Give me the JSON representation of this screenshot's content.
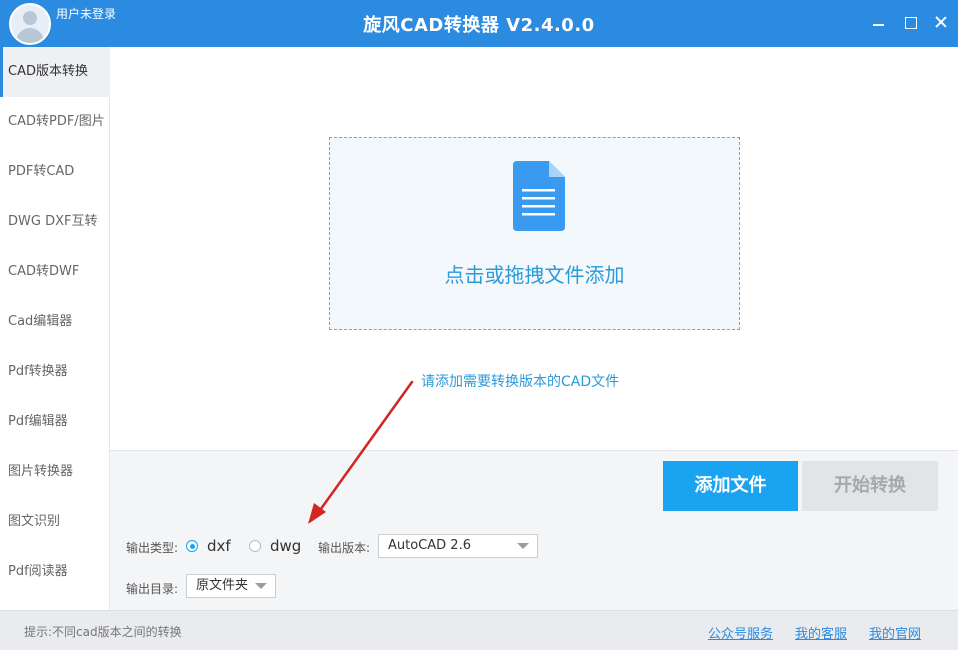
{
  "window": {
    "title": "旋风CAD转换器 V2.4.0.0",
    "user_status": "用户未登录"
  },
  "sidebar": {
    "items": [
      {
        "label": "CAD版本转换",
        "active": true
      },
      {
        "label": "CAD转PDF/图片"
      },
      {
        "label": "PDF转CAD"
      },
      {
        "label": "DWG DXF互转"
      },
      {
        "label": "CAD转DWF"
      },
      {
        "label": "Cad编辑器"
      },
      {
        "label": "Pdf转换器"
      },
      {
        "label": "Pdf编辑器"
      },
      {
        "label": "图片转换器"
      },
      {
        "label": "图文识别"
      },
      {
        "label": "Pdf阅读器"
      }
    ]
  },
  "dropzone": {
    "text": "点击或拖拽文件添加",
    "icon": "document-icon"
  },
  "hint": "请添加需要转换版本的CAD文件",
  "buttons": {
    "add": "添加文件",
    "start": "开始转换"
  },
  "options": {
    "output_type_label": "输出类型:",
    "type_dxf": "dxf",
    "type_dwg": "dwg",
    "selected_type": "dxf",
    "output_version_label": "输出版本:",
    "output_version_value": "AutoCAD 2.6",
    "output_dir_label": "输出目录:",
    "output_dir_value": "原文件夹"
  },
  "statusbar": {
    "tip": "提示:不同cad版本之间的转换",
    "links": [
      "公众号服务",
      "我的客服",
      "我的官网"
    ]
  },
  "colors": {
    "accent": "#2b8be0",
    "button_primary": "#1aa3f0",
    "arrow": "#d42525"
  }
}
